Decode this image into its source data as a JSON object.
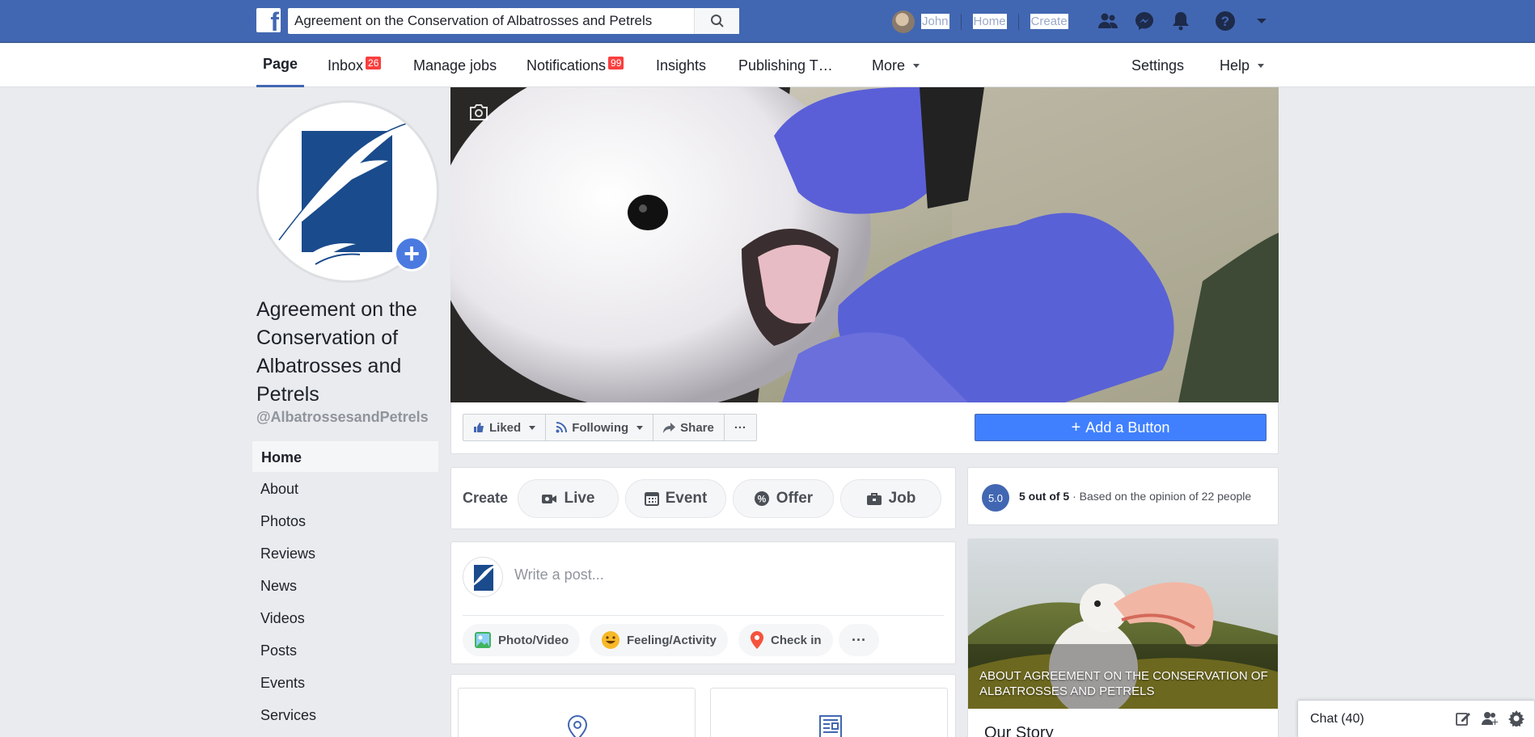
{
  "topbar": {
    "search_value": "Agreement on the Conservation of Albatrosses and Petrels",
    "user_name": "John",
    "home_label": "Home",
    "create_label": "Create"
  },
  "pagenav": {
    "page": "Page",
    "inbox": "Inbox",
    "inbox_count": "26",
    "manage_jobs": "Manage jobs",
    "notifications": "Notifications",
    "notifications_count": "99",
    "insights": "Insights",
    "publishing": "Publishing T…",
    "more": "More",
    "settings": "Settings",
    "help": "Help"
  },
  "profile": {
    "name": "Agreement on the Conservation of Albatrosses and Petrels",
    "handle": "@AlbatrossesandPetrels"
  },
  "leftnav": {
    "items": [
      {
        "label": "Home"
      },
      {
        "label": "About"
      },
      {
        "label": "Photos"
      },
      {
        "label": "Reviews"
      },
      {
        "label": "News"
      },
      {
        "label": "Videos"
      },
      {
        "label": "Posts"
      },
      {
        "label": "Events"
      },
      {
        "label": "Services"
      }
    ]
  },
  "actions": {
    "liked": "Liked",
    "following": "Following",
    "share": "Share",
    "more": "···",
    "add_button": "Add a Button"
  },
  "create": {
    "label": "Create",
    "live": "Live",
    "event": "Event",
    "offer": "Offer",
    "job": "Job"
  },
  "rating": {
    "score": "5.0",
    "bold": "5 out of 5",
    "rest": " · Based on the opinion of 22 people"
  },
  "composer": {
    "placeholder": "Write a post...",
    "photo_video": "Photo/Video",
    "feeling": "Feeling/Activity",
    "check_in": "Check in",
    "more": "···"
  },
  "about": {
    "caption": "About Agreement on the Conservation of Albatrosses and Petrels",
    "our_story": "Our Story"
  },
  "chat": {
    "label": "Chat (40)"
  },
  "colors": {
    "brand": "#4267b2",
    "button": "#4080ff",
    "badge": "#fa3e3e"
  }
}
